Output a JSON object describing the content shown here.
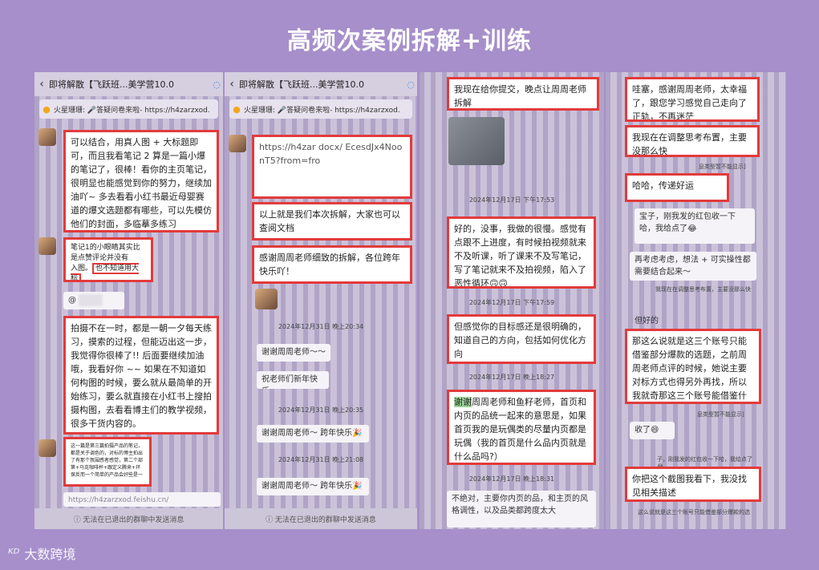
{
  "title": "高频次案例拆解+训练",
  "footer": {
    "logo_mark": "ᴷᴰ",
    "logo_text": "大数跨境"
  },
  "panel1": {
    "back": "‹",
    "header": "即将解散【飞跃班...美学营10.0",
    "pin": "火星珊珊: 🎤答疑问卷来啦- https://h4zarzxod.",
    "msg1": "可以结合，用真人图 + 大标题即可，而且我看笔记 2 算是一篇小爆的笔记了，很棒！看你的主页笔记，很明显也能感觉到你的努力，继续加油吖~ 多去看看小红书最近母婴赛道的爆文选题都有哪些，可以先模仿他们的封面，多临摹多练习",
    "msg2_a": "笔记1的小眼睛其实比",
    "msg2_b": "是点赞评论并没有",
    "msg2_c": "入图。",
    "msg2_quote": "也不知道用大标",
    "mention": "@",
    "msg3": "拍摄不在一时，都是一朝一夕每天练习，摸索的过程，但能迈出这一步，我觉得你很棒了!! 后面要继续加油哦，我看好你 ~~ 如果在不知道如何构图的时候，要么就从最简单的开始练习，要么就直接在小红书上搜拍摄构图，去看看博主们的教学视频，很多干货内容的。",
    "msg4": "这一篇是第三篇拍摄产品的笔记，都是关于调色的，对标的博主拍出了有那个氛围感者感觉，第二个部第+马克咖啡杯+跟定义腾来+环保反而一个简单的产品会好些是一",
    "link": "https://h4zarzxod.feishu.cn/",
    "bottom": "ⓘ 无法在已退出的群聊中发送消息"
  },
  "panel2": {
    "back": "‹",
    "header": "即将解散【飞跃班...美学营10.0",
    "pin": "火星珊珊: 🎤答疑问卷来啦- https://h4zarzxod.",
    "link": "https://h4zar docx/ EcesdJx4Noo nT5?from=fro",
    "msg1": "以上就是我们本次拆解，大家也可以查阅文档",
    "msg2": "感谢周周老师细致的拆解，各位跨年快乐吖！",
    "ts1": "2024年12月31日 晚上20:34",
    "msg3": "谢谢周周老师～～",
    "msg4": "祝老师们新年快乐",
    "ts2": "2024年12月31日 晚上20:35",
    "msg5": "谢谢周周老师～ 跨年快乐🎉",
    "ts3": "2024年12月31日 晚上21:08",
    "msg6": "谢谢周周老师～ 跨年快乐🎉",
    "bottom": "ⓘ 无法在已退出的群聊中发送消息"
  },
  "panel3": {
    "msg1": "我现在给你提交，晚点让周周老师拆解",
    "ts1": "2024年12月17日 下午17:53",
    "msg2": "好的，没事，我做的很慢。感觉有点跟不上进度，有时候拍视频就来不及听课，听了课来不及写笔记，写了笔记就来不及拍视频，陷入了恶性循环🙃🙃",
    "ts2": "2024年12月17日 下午17:59",
    "msg3": "但感觉你的目标感还是很明确的，知道自己的方向，包括如何优化方向",
    "ts3": "2024年12月17日 晚上18:27",
    "msg4_hl": "谢谢",
    "msg4": "周周老师和鱼籽老师，首页和内页的品统一起来的意思是，如果首页我的是玩偶类的尽量内页都是玩偶（我的首页是什么品内页就是什么品吗?）",
    "ts4": "2024年12月17日 晚上18:31",
    "msg5": "不绝对，主要你内页的品，和主页的风格调性，以及品类都跨度太大"
  },
  "panel4": {
    "msg1": "哇塞，感谢周周老师，太幸福了，跟您学习感觉自己走向了正轨，不再迷茫",
    "msg2": "我现在在调整思考布置，主要没那么快",
    "sys1": "息类型暂不能显示]",
    "msg3": "哈哈，传递好运",
    "msg4": "宝子，刚我发的红包收一下哈，我给点了😂",
    "msg5": "再考虑考虑，想法 + 可实操性都需要结合起来～",
    "sys2": "我现在在调整思考布置，主要没那么快",
    "msg6": "但好的",
    "msg7": "那这么说就是这三个账号只能借鉴部分爆款的选题，之前周周老师点评的时候，她说主要对标方式也得另外再找，所以我就奇那这三个账号能借鉴什么呢？想确定一下。",
    "sys3": "息类型暂不能显示]",
    "msg8": "收了😄",
    "sys4": "子，刚我发的红包收一下哈，我给点了😂",
    "msg9": "你把这个截图我看下，我没找见相关描述",
    "sys5": "这么说就是这三个账号只能借鉴部分爆款的选"
  }
}
